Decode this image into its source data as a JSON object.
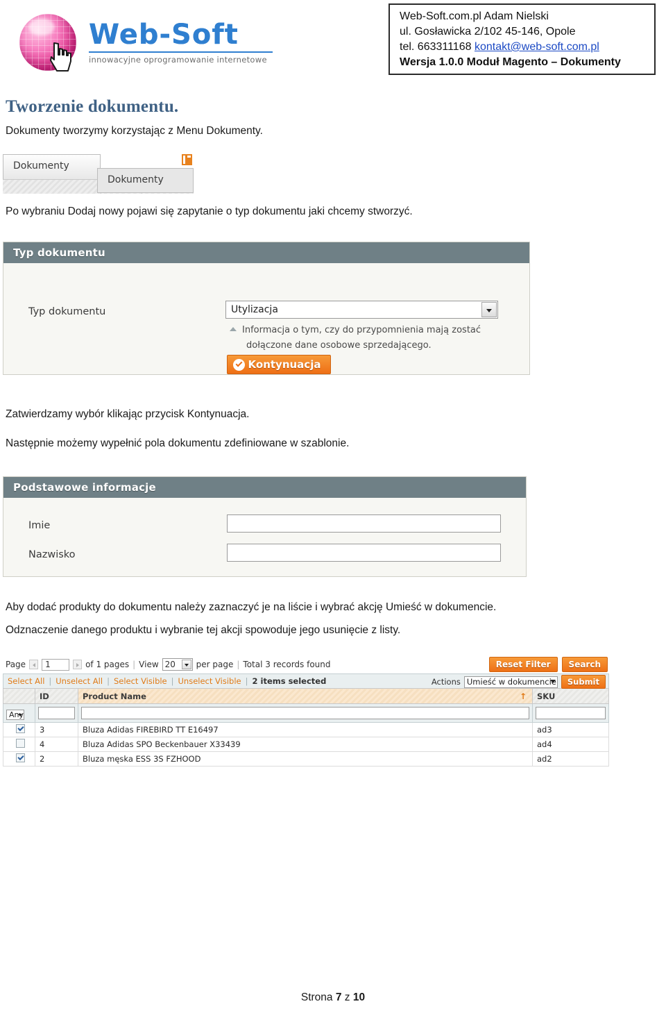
{
  "header": {
    "logo": {
      "wordmark": "Web-Soft",
      "tagline": "innowacyjne oprogramowanie internetowe"
    },
    "contact": {
      "line1": "Web-Soft.com.pl Adam Nielski",
      "line2": "ul. Gosławicka 2/102 45-146, Opole",
      "line3_prefix": "tel. 663311168 ",
      "email": "kontakt@web-soft.com.pl",
      "line4": "Wersja 1.0.0 Moduł Magento – Dokumenty"
    }
  },
  "content": {
    "title": "Tworzenie dokumentu.",
    "intro": "Dokumenty tworzymy korzystając z Menu Dokumenty.",
    "after_menu": "Po wybraniu Dodaj nowy pojawi się zapytanie o typ dokumentu jaki chcemy stworzyć.",
    "after_type": "Zatwierdzamy wybór klikając przycisk Kontynuacja.",
    "after_type2": "Następnie możemy wypełnić pola dokumentu zdefiniowane w szablonie.",
    "after_form": "Aby dodać produkty do dokumentu należy zaznaczyć je na liście i wybrać akcję Umieść w dokumencie.",
    "after_form2": "Odznaczenie danego produktu i wybranie tej akcji spowoduje jego usunięcie z listy."
  },
  "menu_screenshot": {
    "tab_label": "Dokumenty",
    "dropdown_item": "Dokumenty"
  },
  "type_panel": {
    "header": "Typ dokumentu",
    "field_label": "Typ dokumentu",
    "select_value": "Utylizacja",
    "hint_line1": "Informacja o tym, czy do przypomnienia mają zostać",
    "hint_line2": "dołączone dane osobowe sprzedającego.",
    "continue_button": "Kontynuacja"
  },
  "info_panel": {
    "header": "Podstawowe informacje",
    "field1_label": "Imie",
    "field1_value": "",
    "field2_label": "Nazwisko",
    "field2_value": ""
  },
  "grid": {
    "toolbar": {
      "page_label": "Page",
      "page_value": "1",
      "of_pages": "of 1 pages",
      "view_label": "View",
      "view_value": "20",
      "per_page": "per page",
      "total_records": "Total 3 records found",
      "reset_filter_button": "Reset Filter",
      "search_button": "Search"
    },
    "actionbar": {
      "select_all": "Select All",
      "unselect_all": "Unselect All",
      "select_visible": "Select Visible",
      "unselect_visible": "Unselect Visible",
      "selected_count": "2 items selected",
      "actions_label": "Actions",
      "actions_value": "Umieść w dokumencie",
      "submit_button": "Submit"
    },
    "columns": {
      "id": "ID",
      "product_name": "Product Name",
      "sku": "SKU"
    },
    "filters": {
      "any": "Any",
      "id": "",
      "product_name": "",
      "sku": ""
    },
    "rows": [
      {
        "checked": true,
        "id": "3",
        "product_name": "Bluza Adidas FIREBIRD TT E16497",
        "sku": "ad3"
      },
      {
        "checked": false,
        "id": "4",
        "product_name": "Bluza Adidas SPO Beckenbauer X33439",
        "sku": "ad4"
      },
      {
        "checked": true,
        "id": "2",
        "product_name": "Bluza męska ESS 3S FZHOOD",
        "sku": "ad2"
      }
    ]
  },
  "footer": {
    "prefix": "Strona ",
    "page": "7",
    "middle": " z ",
    "total": "10"
  },
  "colors": {
    "title": "#3f6184",
    "panel_header": "#6f8086",
    "accent_orange": "#ee7016",
    "link_blue": "#1b49c4",
    "logo_pink": "#e0338c",
    "logo_blue": "#2f7fd0"
  }
}
